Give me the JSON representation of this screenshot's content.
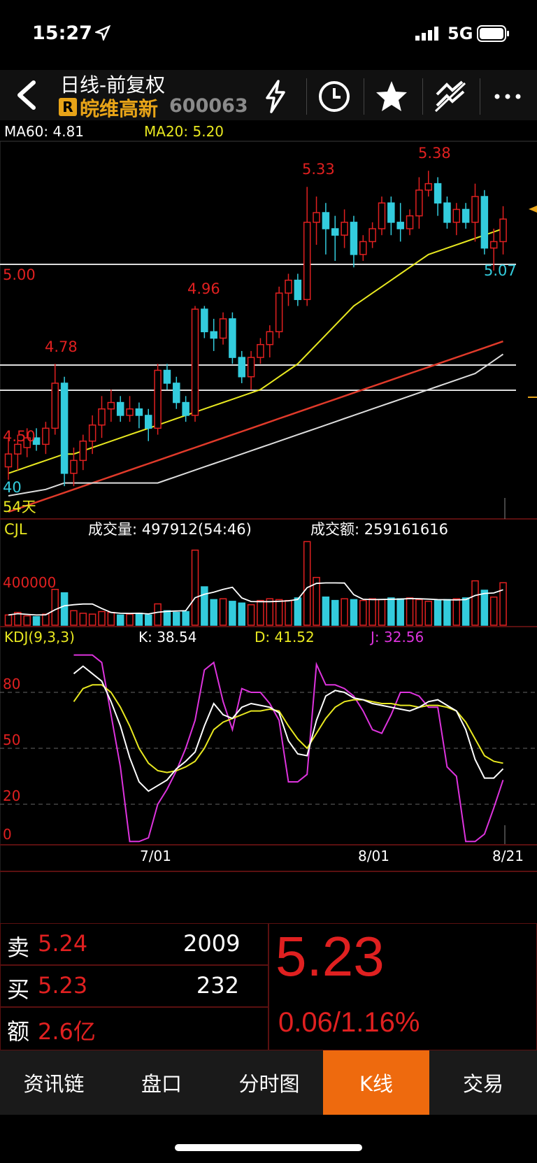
{
  "status_bar": {
    "time": "15:27",
    "network": "5G"
  },
  "header": {
    "title": "日线-前复权",
    "badge": "R",
    "stock_name": "皖维高新",
    "stock_code": "600063"
  },
  "nav_icons": [
    "lightning-icon",
    "clock-icon",
    "star-icon",
    "drawing-tool-icon",
    "more-icon"
  ],
  "indicators": {
    "ma60": "MA60: 4.81",
    "ma20": "MA20: 5.20"
  },
  "price_labels": {
    "hi1": "5.38",
    "hi2": "5.33",
    "hi3": "4.96",
    "hi4": "4.78",
    "lo1": "4.50",
    "lo2": "5.07",
    "level": "5.00",
    "left40": "40",
    "left54": "54天"
  },
  "volume": {
    "name": "CJL",
    "vol_label": "成交量: 497912(54:46)",
    "amt_label": "成交额: 259161616",
    "scale": "400000"
  },
  "kdj": {
    "name": "KDJ(9,3,3)",
    "k": "K: 38.54",
    "d": "D: 41.52",
    "j": "J: 32.56",
    "ticks": [
      "80",
      "50",
      "20",
      "0"
    ]
  },
  "dates": [
    "7/01",
    "8/01",
    "8/21"
  ],
  "quote": {
    "sell_label": "卖",
    "sell_price": "5.24",
    "sell_vol": "2009",
    "buy_label": "买",
    "buy_price": "5.23",
    "buy_vol": "232",
    "amt_label": "额",
    "amount": "2.6亿",
    "last": "5.23",
    "change": "0.06/1.16%"
  },
  "tabs": [
    "资讯链",
    "盘口",
    "分时图",
    "K线",
    "交易"
  ],
  "active_tab": "K线",
  "colors": {
    "up": "#e02020",
    "down": "#33ccdd",
    "accent": "#ee6a0e",
    "ma": "#e8e820",
    "kdj_j": "#dd33dd"
  },
  "chart_data": {
    "type": "candlestick",
    "ohlc": [
      [
        4.46,
        4.55,
        4.42,
        4.5
      ],
      [
        4.5,
        4.56,
        4.45,
        4.53
      ],
      [
        4.52,
        4.58,
        4.49,
        4.55
      ],
      [
        4.55,
        4.58,
        4.51,
        4.53
      ],
      [
        4.53,
        4.6,
        4.5,
        4.58
      ],
      [
        4.58,
        4.78,
        4.56,
        4.72
      ],
      [
        4.72,
        4.74,
        4.4,
        4.44
      ],
      [
        4.44,
        4.52,
        4.4,
        4.48
      ],
      [
        4.48,
        4.56,
        4.45,
        4.54
      ],
      [
        4.54,
        4.62,
        4.5,
        4.59
      ],
      [
        4.59,
        4.68,
        4.55,
        4.64
      ],
      [
        4.64,
        4.7,
        4.6,
        4.66
      ],
      [
        4.66,
        4.68,
        4.6,
        4.62
      ],
      [
        4.62,
        4.68,
        4.6,
        4.64
      ],
      [
        4.64,
        4.66,
        4.58,
        4.62
      ],
      [
        4.62,
        4.64,
        4.54,
        4.58
      ],
      [
        4.58,
        4.78,
        4.56,
        4.76
      ],
      [
        4.76,
        4.78,
        4.7,
        4.72
      ],
      [
        4.72,
        4.74,
        4.64,
        4.66
      ],
      [
        4.66,
        4.68,
        4.6,
        4.62
      ],
      [
        4.62,
        4.96,
        4.6,
        4.95
      ],
      [
        4.95,
        4.96,
        4.86,
        4.88
      ],
      [
        4.88,
        4.92,
        4.82,
        4.86
      ],
      [
        4.86,
        4.94,
        4.84,
        4.92
      ],
      [
        4.92,
        4.94,
        4.78,
        4.8
      ],
      [
        4.8,
        4.82,
        4.72,
        4.74
      ],
      [
        4.74,
        4.82,
        4.7,
        4.8
      ],
      [
        4.8,
        4.86,
        4.78,
        4.84
      ],
      [
        4.84,
        4.9,
        4.8,
        4.88
      ],
      [
        4.88,
        5.02,
        4.86,
        5.0
      ],
      [
        5.0,
        5.06,
        4.96,
        5.04
      ],
      [
        5.04,
        5.06,
        4.96,
        4.98
      ],
      [
        4.98,
        5.33,
        4.96,
        5.22
      ],
      [
        5.22,
        5.3,
        5.15,
        5.25
      ],
      [
        5.25,
        5.28,
        5.12,
        5.2
      ],
      [
        5.2,
        5.24,
        5.1,
        5.18
      ],
      [
        5.18,
        5.26,
        5.14,
        5.22
      ],
      [
        5.22,
        5.24,
        5.08,
        5.12
      ],
      [
        5.12,
        5.18,
        5.1,
        5.16
      ],
      [
        5.16,
        5.22,
        5.14,
        5.2
      ],
      [
        5.2,
        5.3,
        5.18,
        5.28
      ],
      [
        5.28,
        5.3,
        5.18,
        5.22
      ],
      [
        5.22,
        5.28,
        5.16,
        5.2
      ],
      [
        5.2,
        5.26,
        5.18,
        5.24
      ],
      [
        5.24,
        5.36,
        5.2,
        5.32
      ],
      [
        5.32,
        5.38,
        5.3,
        5.34
      ],
      [
        5.34,
        5.36,
        5.24,
        5.28
      ],
      [
        5.28,
        5.3,
        5.2,
        5.22
      ],
      [
        5.22,
        5.28,
        5.18,
        5.26
      ],
      [
        5.26,
        5.28,
        5.2,
        5.22
      ],
      [
        5.22,
        5.34,
        5.16,
        5.3
      ],
      [
        5.3,
        5.32,
        5.12,
        5.14
      ],
      [
        5.14,
        5.2,
        5.07,
        5.16
      ],
      [
        5.16,
        5.27,
        5.12,
        5.23
      ]
    ],
    "ma20": [
      4.44,
      4.45,
      4.46,
      4.47,
      4.48,
      4.49,
      4.5,
      4.5,
      4.51,
      4.52,
      4.53,
      4.54,
      4.55,
      4.56,
      4.57,
      4.58,
      4.59,
      4.6,
      4.61,
      4.62,
      4.63,
      4.64,
      4.65,
      4.66,
      4.67,
      4.68,
      4.69,
      4.7,
      4.72,
      4.74,
      4.76,
      4.78,
      4.81,
      4.84,
      4.87,
      4.9,
      4.93,
      4.96,
      4.98,
      5.0,
      5.02,
      5.04,
      5.06,
      5.08,
      5.1,
      5.12,
      5.13,
      5.14,
      5.15,
      5.16,
      5.17,
      5.18,
      5.19,
      5.2
    ],
    "ma60": [
      4.37,
      4.375,
      4.38,
      4.385,
      4.39,
      4.4,
      4.41,
      4.41,
      4.41,
      4.41,
      4.41,
      4.41,
      4.41,
      4.41,
      4.41,
      4.41,
      4.41,
      4.42,
      4.43,
      4.44,
      4.45,
      4.46,
      4.47,
      4.48,
      4.49,
      4.5,
      4.51,
      4.52,
      4.53,
      4.54,
      4.55,
      4.56,
      4.57,
      4.58,
      4.59,
      4.6,
      4.61,
      4.62,
      4.63,
      4.64,
      4.65,
      4.66,
      4.67,
      4.68,
      4.69,
      4.7,
      4.71,
      4.72,
      4.73,
      4.74,
      4.75,
      4.77,
      4.79,
      4.81
    ],
    "ma_long": [
      4.32,
      4.33,
      4.34,
      4.35,
      4.36,
      4.37,
      4.38,
      4.39,
      4.4,
      4.41,
      4.42,
      4.43,
      4.44,
      4.45,
      4.46,
      4.47,
      4.48,
      4.49,
      4.5,
      4.51,
      4.52,
      4.53,
      4.54,
      4.55,
      4.56,
      4.57,
      4.58,
      4.59,
      4.6,
      4.61,
      4.62,
      4.63,
      4.64,
      4.65,
      4.66,
      4.67,
      4.68,
      4.69,
      4.7,
      4.71,
      4.72,
      4.73,
      4.74,
      4.75,
      4.76,
      4.77,
      4.78,
      4.79,
      4.8,
      4.81,
      4.82,
      4.83,
      4.84,
      4.85
    ],
    "volume": [
      120000,
      150000,
      110000,
      100000,
      130000,
      420000,
      380000,
      170000,
      140000,
      130000,
      160000,
      150000,
      120000,
      130000,
      140000,
      120000,
      250000,
      170000,
      150000,
      160000,
      880000,
      450000,
      300000,
      310000,
      280000,
      260000,
      240000,
      290000,
      310000,
      300000,
      290000,
      320000,
      980000,
      560000,
      330000,
      290000,
      310000,
      300000,
      290000,
      310000,
      300000,
      320000,
      310000,
      320000,
      300000,
      280000,
      290000,
      300000,
      310000,
      320000,
      520000,
      410000,
      330000,
      497912
    ],
    "kdj_k": [
      90,
      94,
      90,
      86,
      75,
      62,
      45,
      32,
      27,
      30,
      33,
      39,
      43,
      48,
      62,
      74,
      68,
      66,
      72,
      74,
      73,
      72,
      69,
      54,
      47,
      46,
      65,
      78,
      81,
      80,
      77,
      76,
      74,
      73,
      72,
      71,
      70,
      72,
      75,
      76,
      73,
      70,
      60,
      44,
      34,
      34,
      39
    ],
    "kdj_d": [
      75,
      82,
      84,
      84,
      80,
      72,
      62,
      50,
      42,
      38,
      37,
      38,
      40,
      43,
      50,
      60,
      64,
      66,
      68,
      70,
      70,
      71,
      70,
      62,
      55,
      50,
      58,
      66,
      72,
      75,
      76,
      76,
      75,
      74,
      74,
      73,
      73,
      72,
      73,
      73,
      72,
      70,
      64,
      55,
      46,
      43,
      42
    ],
    "kdj_j": [
      100,
      100,
      100,
      96,
      68,
      40,
      0,
      0,
      2,
      20,
      28,
      38,
      50,
      65,
      92,
      96,
      75,
      60,
      82,
      80,
      80,
      74,
      65,
      32,
      32,
      36,
      95,
      84,
      84,
      82,
      78,
      70,
      60,
      58,
      68,
      80,
      80,
      78,
      72,
      72,
      40,
      35,
      0,
      0,
      4,
      18,
      33
    ],
    "price_ylim": [
      4.32,
      5.45
    ],
    "volume_ylim": [
      0,
      1000000
    ],
    "kdj_ylim": [
      0,
      100
    ]
  }
}
